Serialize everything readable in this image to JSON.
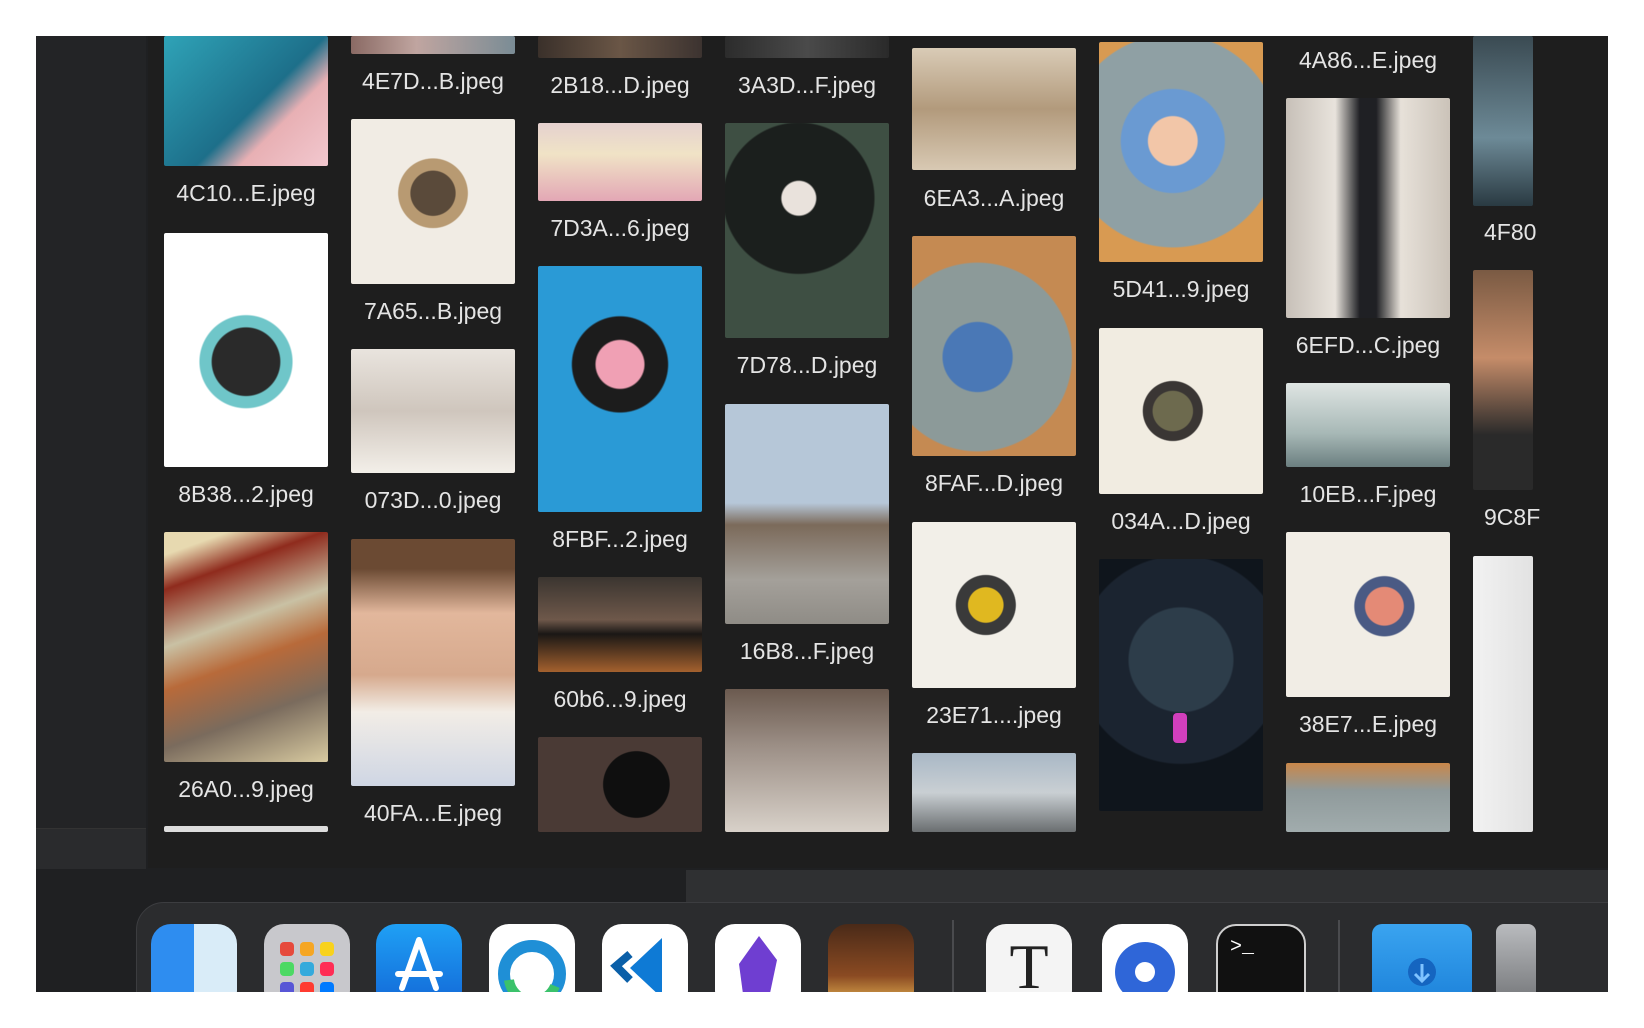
{
  "files": {
    "c1": [
      "4C10...E.jpeg",
      "8B38...2.jpeg",
      "26A0...9.jpeg"
    ],
    "c2": [
      "4E7D...B.jpeg",
      "7A65...B.jpeg",
      "073D...0.jpeg",
      "40FA...E.jpeg"
    ],
    "c3": [
      "2B18...D.jpeg",
      "7D3A...6.jpeg",
      "8FBF...2.jpeg",
      "60b6...9.jpeg"
    ],
    "c4": [
      "3A3D...F.jpeg",
      "7D78...D.jpeg",
      "16B8...F.jpeg"
    ],
    "c5": [
      "6EA3...A.jpeg",
      "8FAF...D.jpeg",
      "23E71....jpeg"
    ],
    "c6": [
      "5D41...9.jpeg",
      "034A...D.jpeg"
    ],
    "c7": [
      "4A86...E.jpeg",
      "6EFD...C.jpeg",
      "10EB...F.jpeg",
      "38E7...E.jpeg"
    ],
    "c8": [
      "4F80",
      "9C8F"
    ]
  },
  "dock": {
    "apps": [
      "finder-icon",
      "launchpad-icon",
      "app-store-icon",
      "edge-icon",
      "vscode-icon",
      "obsidian-icon",
      "orange-app-icon",
      "typora-icon",
      "disk-utility-icon",
      "terminal-icon",
      "downloads-folder-icon",
      "trash-icon"
    ],
    "terminal_glyph": ">_",
    "typora_glyph": "T"
  }
}
